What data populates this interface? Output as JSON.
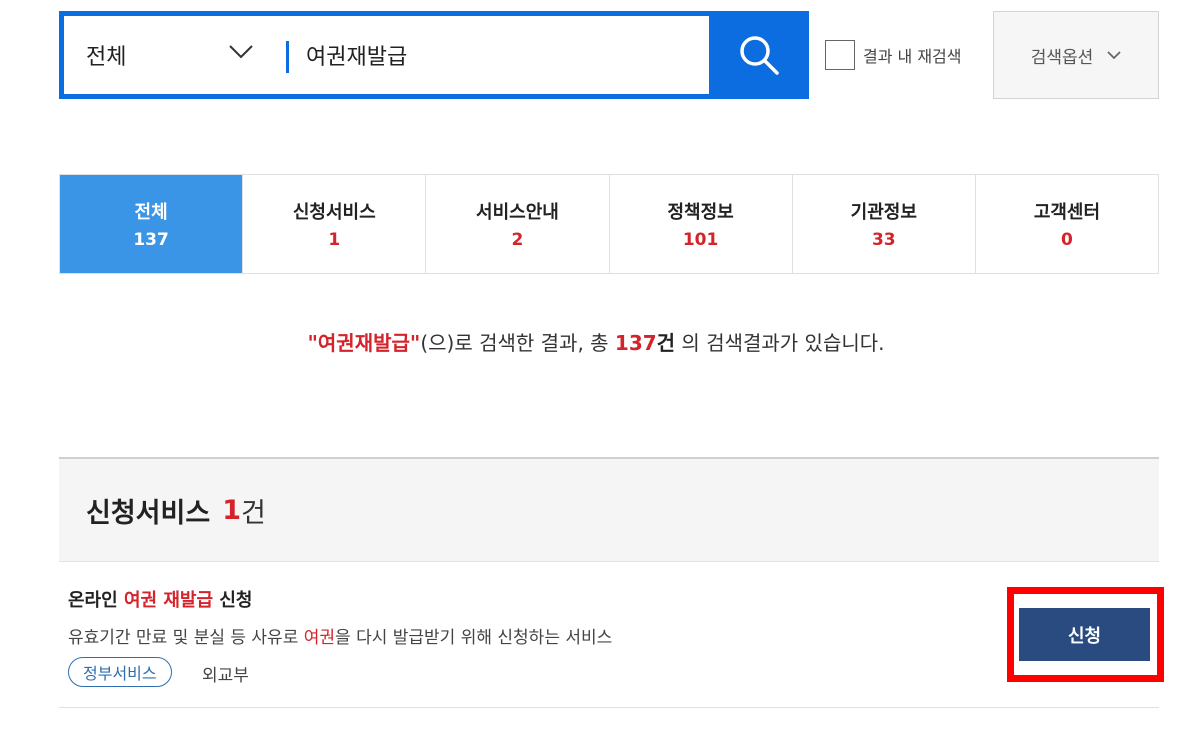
{
  "search": {
    "scope": "전체",
    "query": "여권재발급",
    "re_search_label": "결과 내 재검색",
    "options_label": "검색옵션"
  },
  "tabs": [
    {
      "label": "전체",
      "count": "137",
      "active": true
    },
    {
      "label": "신청서비스",
      "count": "1"
    },
    {
      "label": "서비스안내",
      "count": "2"
    },
    {
      "label": "정책정보",
      "count": "101"
    },
    {
      "label": "기관정보",
      "count": "33"
    },
    {
      "label": "고객센터",
      "count": "0"
    }
  ],
  "summary": {
    "query_quoted": "\"여권재발급\"",
    "text1": "(으)로 검색한 결과, 총 ",
    "total": "137",
    "unit": "건",
    "text2": " 의 검색결과가 있습니다."
  },
  "section": {
    "title": "신청서비스",
    "count": "1",
    "unit": "건"
  },
  "result": {
    "title_pre": "온라인 ",
    "title_hl1": "여권",
    "title_sp": " ",
    "title_hl2": "재발급",
    "title_post": " 신청",
    "desc_pre": "유효기간 만료 및 분실 등 사유로 ",
    "desc_hl": "여권",
    "desc_post": "을 다시 발급받기 위해 신청하는 서비스",
    "tag": "정부서비스",
    "org": "외교부",
    "apply_label": "신청"
  },
  "colors": {
    "brand_blue": "#0b6ddf",
    "active_tab": "#3b95e6",
    "highlight_red": "#d4232a",
    "apply_navy": "#294b7f",
    "annotation_red": "#ff0000"
  }
}
